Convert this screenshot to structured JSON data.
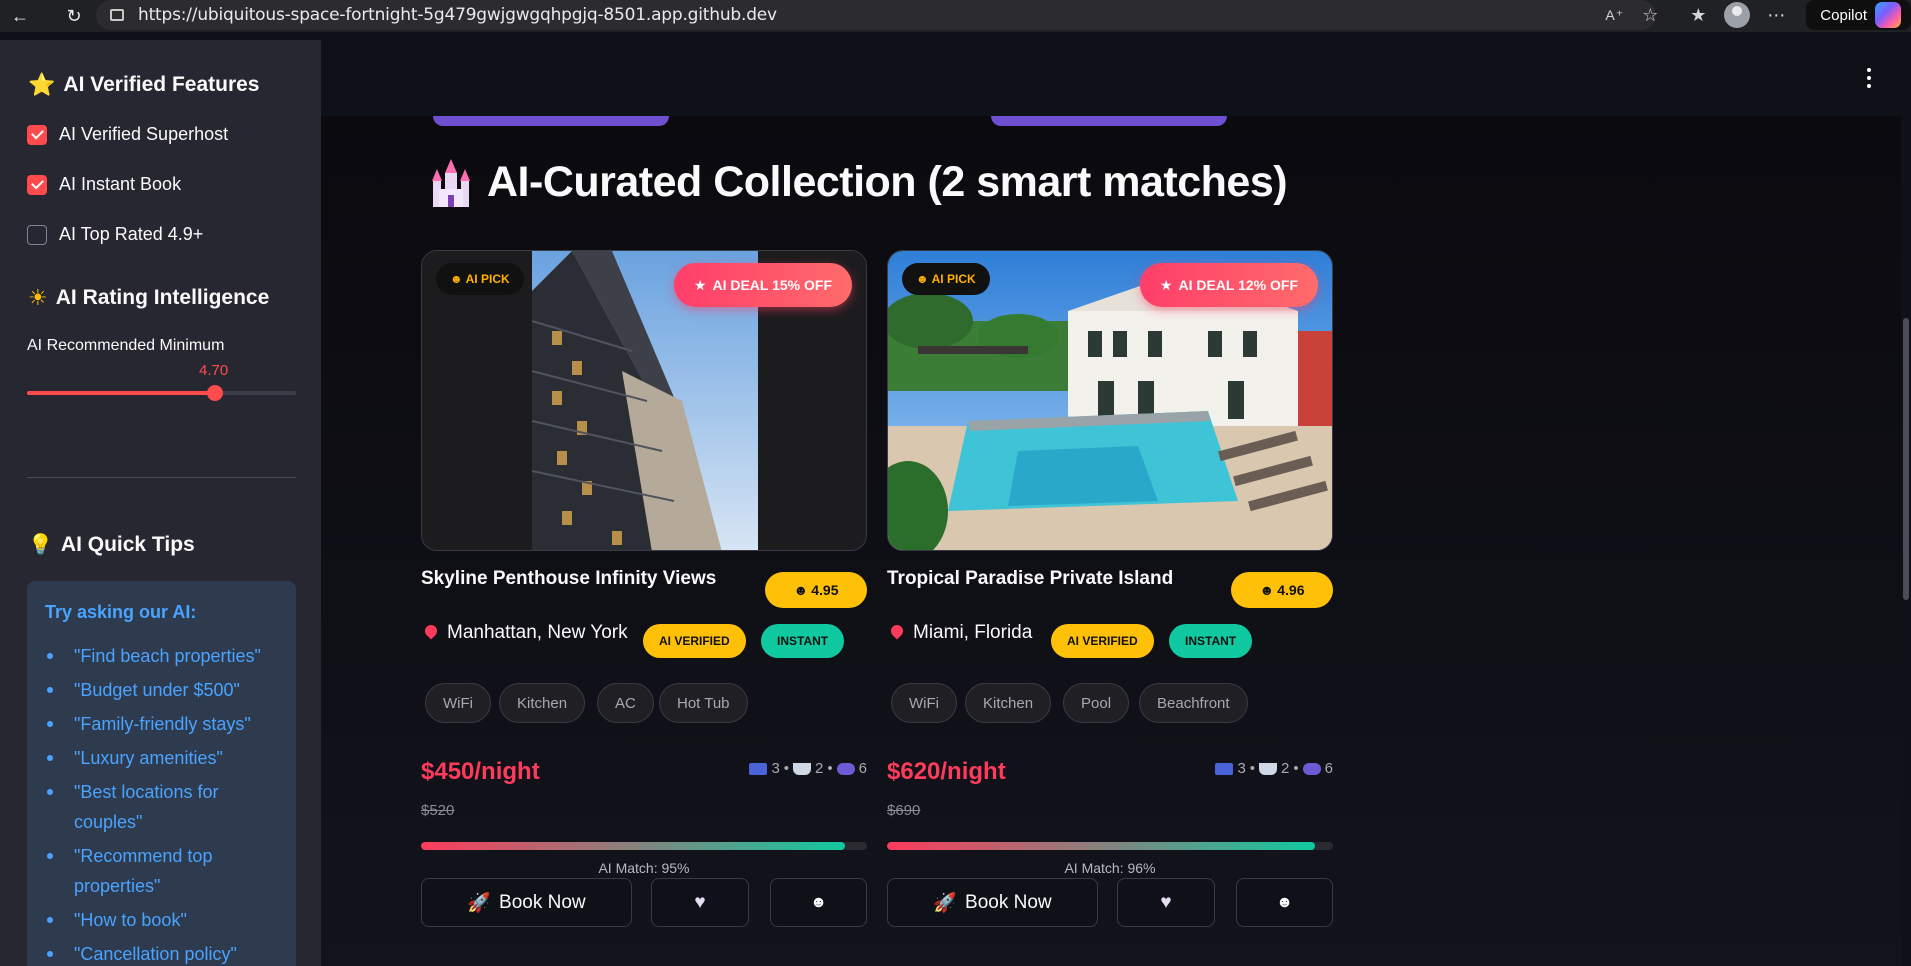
{
  "browser": {
    "url": "https://ubiquitous-space-fortnight-5g479gwjgwgqhpgjq-8501.app.github.dev",
    "copilot_label": "Copilot"
  },
  "sidebar": {
    "features_heading": "AI Verified Features",
    "checkboxes": [
      {
        "label": "AI Verified Superhost",
        "checked": true
      },
      {
        "label": "AI Instant Book",
        "checked": true
      },
      {
        "label": "AI Top Rated 4.9+",
        "checked": false
      }
    ],
    "rating_heading": "AI Rating Intelligence",
    "slider": {
      "label": "AI Recommended Minimum",
      "value": "4.70",
      "fraction": 0.7
    },
    "tips_heading": "AI Quick Tips",
    "tips_box_title": "Try asking our AI:",
    "tips": [
      "\"Find beach properties\"",
      "\"Budget under $500\"",
      "\"Family-friendly stays\"",
      "\"Luxury amenities\"",
      "\"Best locations for couples\"",
      "\"Recommend top properties\"",
      "\"How to book\"",
      "\"Cancellation policy\""
    ]
  },
  "main": {
    "title": "AI-Curated Collection (2 smart matches)",
    "cards": [
      {
        "pick": "AI PICK",
        "deal": "AI DEAL 15% OFF",
        "title": "Skyline Penthouse Infinity Views",
        "rating": "4.95",
        "location": "Manhattan, New York",
        "badge_verified": "AI VERIFIED",
        "badge_instant": "INSTANT",
        "amenities": [
          "WiFi",
          "Kitchen",
          "AC",
          "Hot Tub"
        ],
        "price": "$450/night",
        "old_price": "$520",
        "beds": "3",
        "baths": "2",
        "guests": "6",
        "match_fraction": 0.95,
        "match": "AI Match: 95%",
        "book": "Book Now"
      },
      {
        "pick": "AI PICK",
        "deal": "AI DEAL 12% OFF",
        "title": "Tropical Paradise Private Island",
        "rating": "4.96",
        "location": "Miami, Florida",
        "badge_verified": "AI VERIFIED",
        "badge_instant": "INSTANT",
        "amenities": [
          "WiFi",
          "Kitchen",
          "Pool",
          "Beachfront"
        ],
        "price": "$620/night",
        "old_price": "$690",
        "beds": "3",
        "baths": "2",
        "guests": "6",
        "match_fraction": 0.96,
        "match": "AI Match: 96%",
        "book": "Book Now"
      }
    ]
  }
}
